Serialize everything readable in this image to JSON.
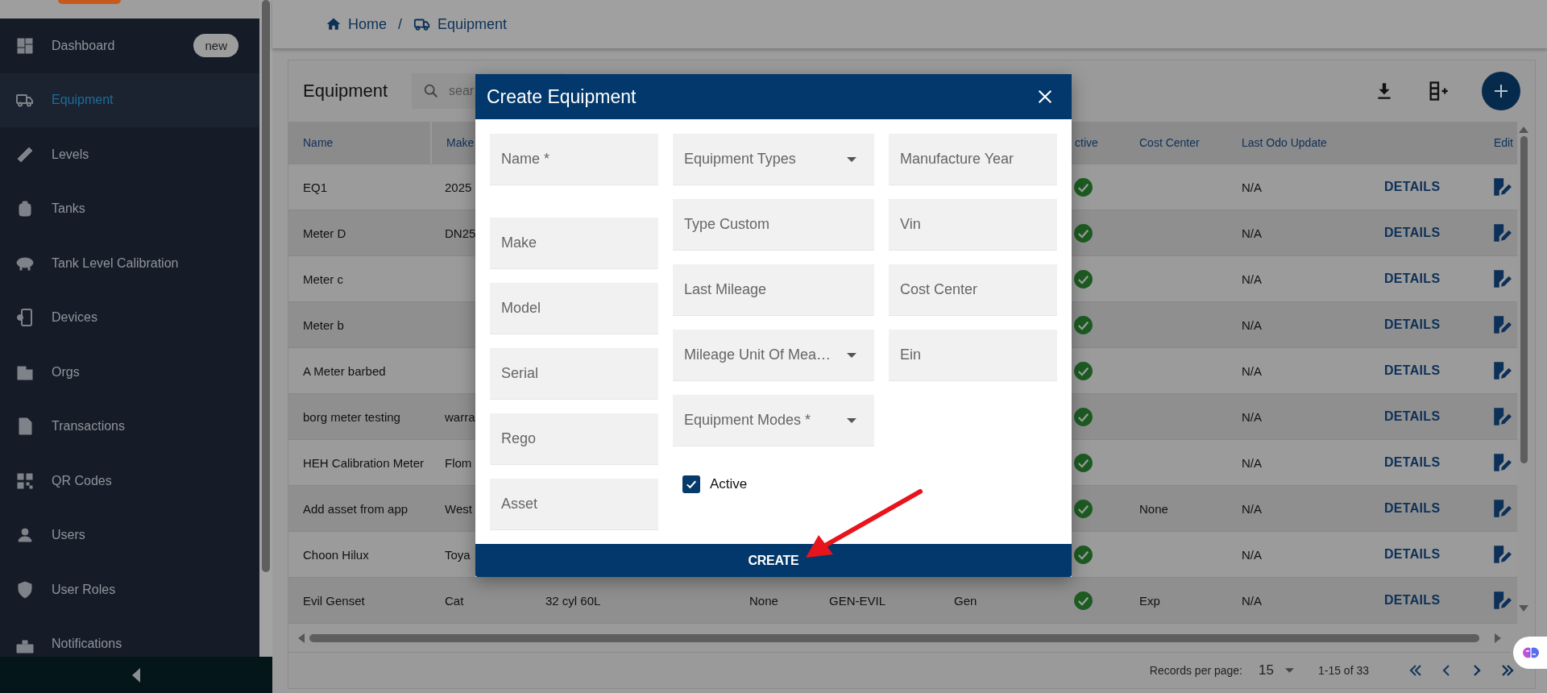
{
  "sidebar": {
    "items": [
      {
        "label": "Dashboard",
        "badge": "new",
        "selected": false
      },
      {
        "label": "Equipment",
        "selected": true
      },
      {
        "label": "Levels",
        "selected": false
      },
      {
        "label": "Tanks",
        "selected": false
      },
      {
        "label": "Tank Level Calibration",
        "selected": false
      },
      {
        "label": "Devices",
        "selected": false
      },
      {
        "label": "Orgs",
        "selected": false
      },
      {
        "label": "Transactions",
        "selected": false
      },
      {
        "label": "QR Codes",
        "selected": false
      },
      {
        "label": "Users",
        "selected": false
      },
      {
        "label": "User Roles",
        "selected": false
      },
      {
        "label": "Notifications",
        "selected": false
      }
    ]
  },
  "breadcrumb": {
    "items": [
      "Home",
      "Equipment"
    ],
    "separator": "/"
  },
  "card": {
    "title": "Equipment",
    "search": {
      "placeholder": "sear"
    }
  },
  "table": {
    "columns": {
      "name": "Name",
      "make": "Make",
      "active": "ctive",
      "cost_center": "Cost Center",
      "last_odo": "Last Odo Update",
      "edit": "Edit"
    },
    "rows": [
      {
        "name": "EQ1",
        "make": "2025",
        "active": true,
        "last_odo": "N/A",
        "details": "DETAILS"
      },
      {
        "name": "Meter D",
        "make": "DN25",
        "active": true,
        "last_odo": "N/A",
        "details": "DETAILS"
      },
      {
        "name": "Meter c",
        "active": true,
        "last_odo": "N/A",
        "details": "DETAILS"
      },
      {
        "name": "Meter b",
        "active": true,
        "last_odo": "N/A",
        "details": "DETAILS"
      },
      {
        "name": "A Meter barbed",
        "active": true,
        "last_odo": "N/A",
        "details": "DETAILS"
      },
      {
        "name": "borg meter testing",
        "make": "warra",
        "active": true,
        "last_odo": "N/A",
        "details": "DETAILS"
      },
      {
        "name": "HEH Calibration Meter",
        "make": "Flom",
        "active": true,
        "last_odo": "N/A",
        "details": "DETAILS"
      },
      {
        "name": "Add asset from app",
        "make": "West",
        "active": true,
        "cost_center": "None",
        "last_odo": "N/A",
        "details": "DETAILS"
      },
      {
        "name": "Choon Hilux",
        "make": "Toya",
        "active": true,
        "last_odo": "N/A",
        "details": "DETAILS"
      },
      {
        "name": "Evil Genset",
        "make": "Cat",
        "model": "32 cyl 60L",
        "column_4": "None",
        "column_5": "GEN-EVIL",
        "column_6": "Gen",
        "active": true,
        "cost_center": "Exp",
        "last_odo": "N/A",
        "details": "DETAILS"
      }
    ]
  },
  "pagination": {
    "records_label": "Records per page:",
    "per_page": "15",
    "range": "1-15 of 33"
  },
  "dialog": {
    "title": "Create Equipment",
    "columns": [
      [
        {
          "kind": "text",
          "placeholder": "Name *"
        },
        {
          "kind": "text",
          "placeholder": "Make"
        },
        {
          "kind": "text",
          "placeholder": "Model"
        },
        {
          "kind": "text",
          "placeholder": "Serial"
        },
        {
          "kind": "text",
          "placeholder": "Rego"
        },
        {
          "kind": "text",
          "placeholder": "Asset"
        }
      ],
      [
        {
          "kind": "select",
          "placeholder": "Equipment Types"
        },
        {
          "kind": "text",
          "placeholder": "Type Custom"
        },
        {
          "kind": "text",
          "placeholder": "Last Mileage"
        },
        {
          "kind": "select",
          "placeholder": "Mileage Unit Of Mea…"
        },
        {
          "kind": "select",
          "placeholder": "Equipment Modes *"
        }
      ],
      [
        {
          "kind": "text",
          "placeholder": "Manufacture Year"
        },
        {
          "kind": "text",
          "placeholder": "Vin"
        },
        {
          "kind": "text",
          "placeholder": "Cost Center"
        },
        {
          "kind": "text",
          "placeholder": "Ein"
        }
      ]
    ],
    "active": {
      "label": "Active",
      "checked": true
    },
    "button": "CREATE"
  }
}
